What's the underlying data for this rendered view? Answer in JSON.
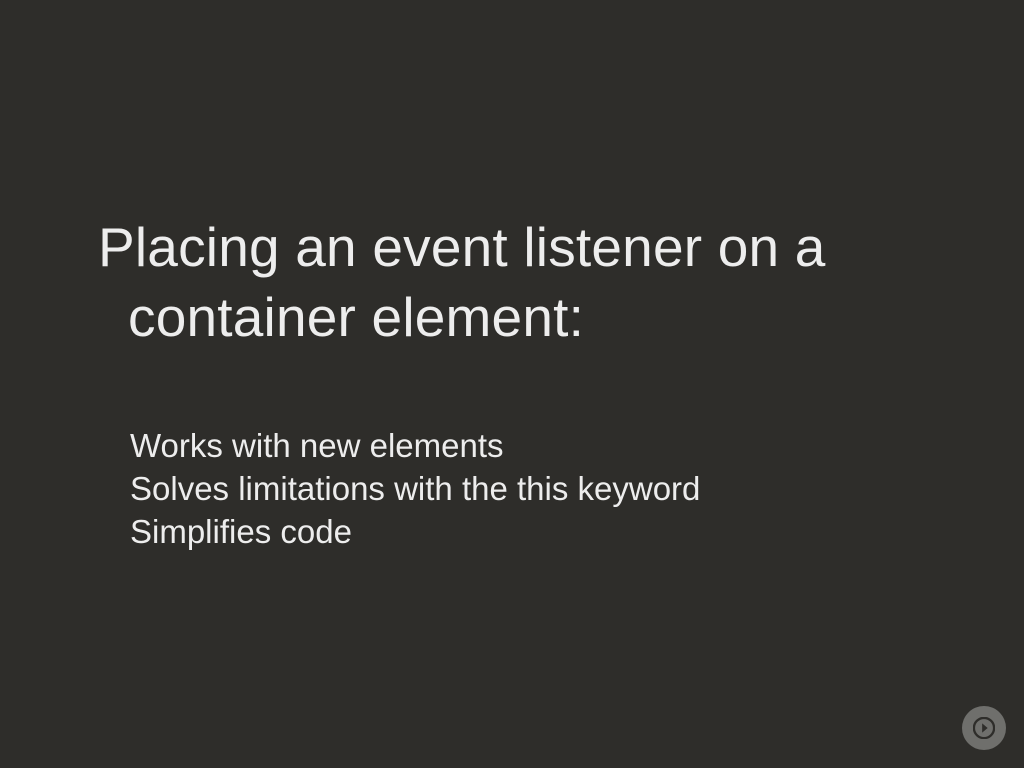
{
  "heading": {
    "line1": "Placing an event listener on a",
    "line2": "container element:"
  },
  "points": {
    "p1": "Works with new elements",
    "p2": "Solves limitations with the this keyword",
    "p3": "Simplifies code"
  },
  "nav": {
    "next_label": "Next slide"
  }
}
